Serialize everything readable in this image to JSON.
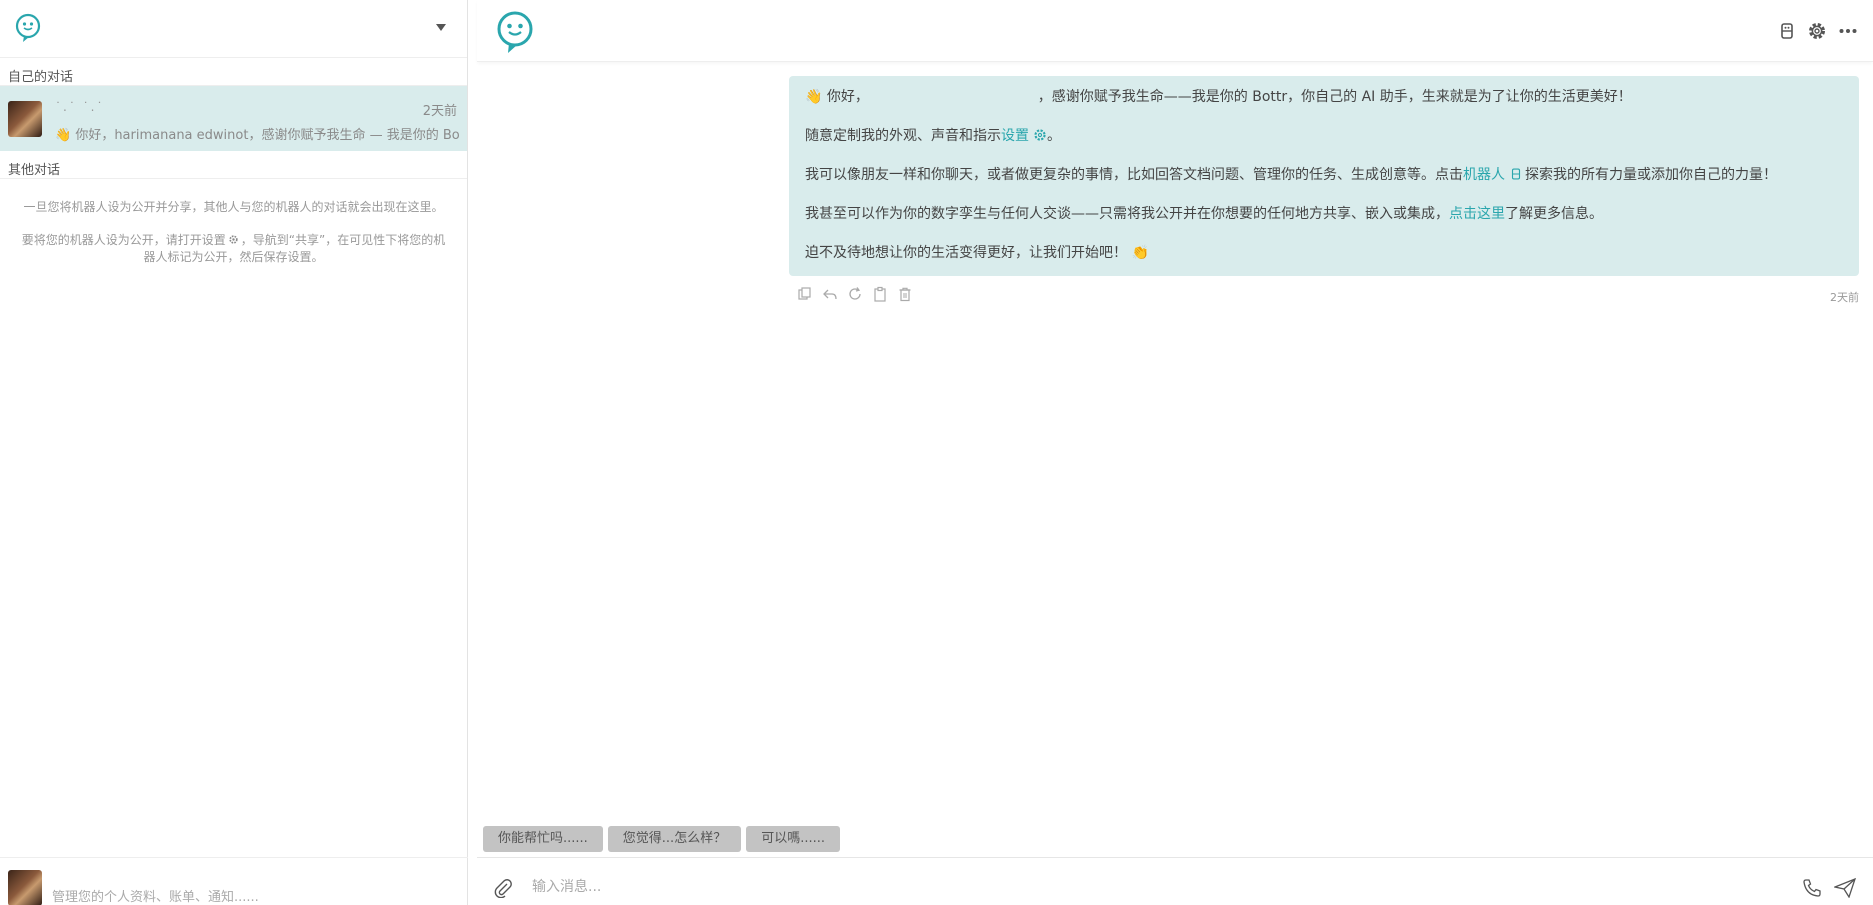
{
  "sidebar": {
    "own_section_label": "自己的对话",
    "other_section_label": "其他对话",
    "conversation": {
      "name": "˙.˙ ˙.˙",
      "time": "2天前",
      "preview": "👋 你好，harimanana edwinot，感谢你赋予我生命 — 我是你的 Bottr，你自己的 AI 助手，生来就是为了让你的生活更美好！"
    },
    "hint_1": "一旦您将机器人设为公开并分享，其他人与您的机器人的对话就会出现在这里。",
    "hint_2a": "要将您的机器人设为公开，请打开设置",
    "hint_2b": "，导航到“共享”，在可见性下将您的机器人标记为公开，然后保存设置。",
    "footer_text": "管理您的个人资料、账单、通知......"
  },
  "message": {
    "greeting_emoji": "👋",
    "p1_a": "你好，",
    "p1_b": "，感谢你赋予我生命——我是你的 Bottr，你自己的 AI 助手，生来就是为了让你的生活更美好！",
    "p2_a": "随意定制我的外观、声音和指示",
    "p2_link": "设置",
    "p2_b": "。",
    "p3_a": "我可以像朋友一样和你聊天，或者做更复杂的事情，比如回答文档问题、管理你的任务、生成创意等。点击",
    "p3_link": "机器人",
    "p3_b": "探索我的所有力量或添加你自己的力量！",
    "p4_a": "我甚至可以作为你的数字孪生与任何人交谈——只需将我公开并在你想要的任何地方共享、嵌入或集成，",
    "p4_link": "点击这里",
    "p4_b": "了解更多信息。",
    "p5": "迫不及待地想让你的生活变得更好，让我们开始吧！",
    "p5_emoji": "👏",
    "time": "2天前"
  },
  "suggestions": [
    "你能帮忙吗......",
    "您觉得...怎么样？",
    "可以嗎......"
  ],
  "composer": {
    "placeholder": "输入消息..."
  },
  "colors": {
    "accent": "#2aa6ad",
    "bubble": "#d9ecec",
    "chip": "#c3c3c3"
  },
  "icons": [
    "bot-icon",
    "gear-icon",
    "more-icon",
    "copy-icon",
    "reply-icon",
    "refresh-icon",
    "clipboard-icon",
    "trash-icon",
    "paperclip-icon",
    "phone-icon",
    "send-icon"
  ]
}
